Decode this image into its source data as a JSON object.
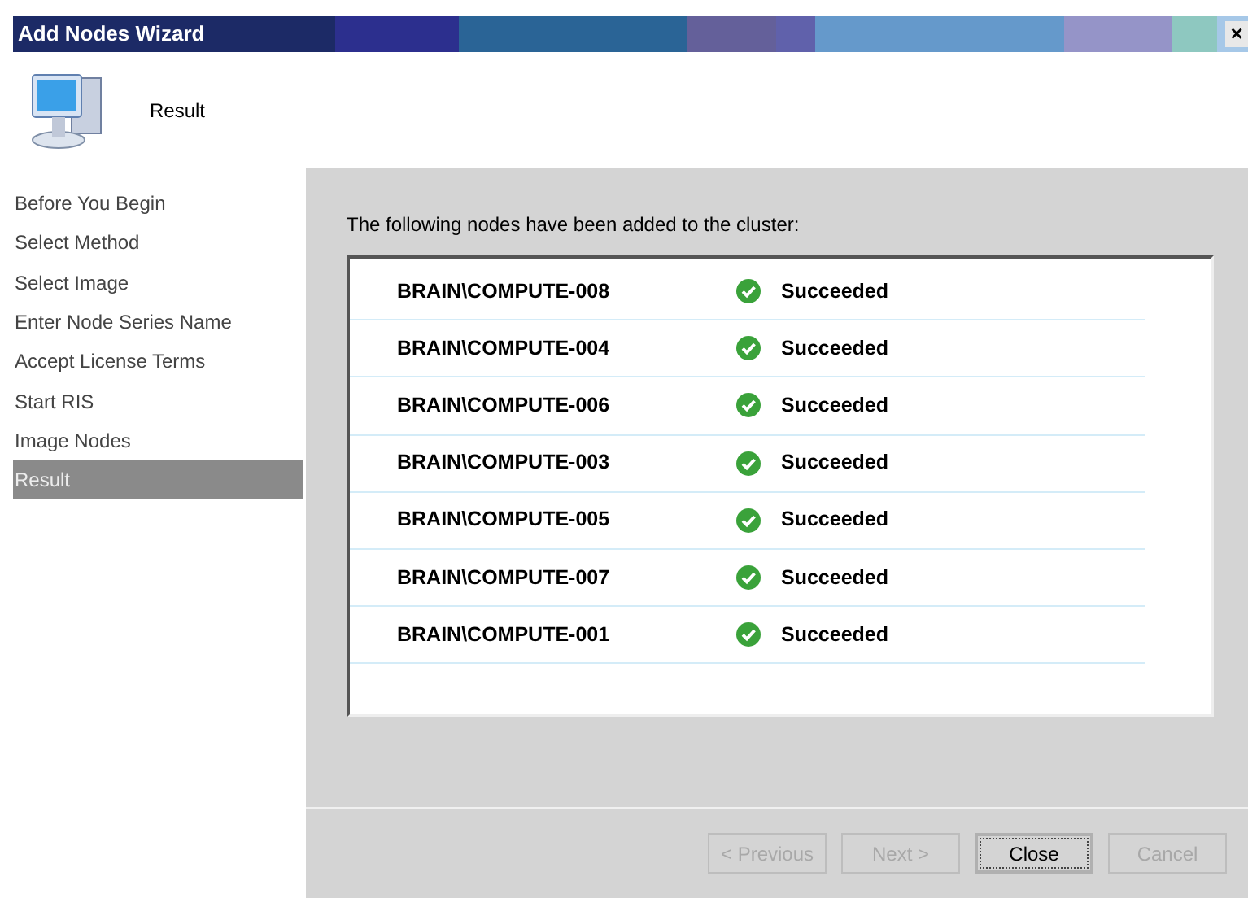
{
  "window": {
    "title": "Add Nodes Wizard",
    "close": "×"
  },
  "header": {
    "title": "Result"
  },
  "steps": [
    {
      "label": "Before You Begin",
      "selected": false
    },
    {
      "label": "Select Method",
      "selected": false
    },
    {
      "label": "Select Image",
      "selected": false
    },
    {
      "label": "Enter Node Series Name",
      "selected": false
    },
    {
      "label": "Accept License Terms",
      "selected": false
    },
    {
      "label": "Start RIS",
      "selected": false
    },
    {
      "label": "Image Nodes",
      "selected": false
    },
    {
      "label": "Result",
      "selected": true
    }
  ],
  "intro": "The following nodes have been added to the cluster:",
  "nodes": [
    {
      "name": "BRAIN\\COMPUTE-008",
      "status": "Succeeded"
    },
    {
      "name": "BRAIN\\COMPUTE-004",
      "status": "Succeeded"
    },
    {
      "name": "BRAIN\\COMPUTE-006",
      "status": "Succeeded"
    },
    {
      "name": "BRAIN\\COMPUTE-003",
      "status": "Succeeded"
    },
    {
      "name": "BRAIN\\COMPUTE-005",
      "status": "Succeeded"
    },
    {
      "name": "BRAIN\\COMPUTE-007",
      "status": "Succeeded"
    },
    {
      "name": "BRAIN\\COMPUTE-001",
      "status": "Succeeded"
    }
  ],
  "buttons": [
    {
      "label": "< Previous",
      "disabled": true,
      "default": false
    },
    {
      "label": "Next >",
      "disabled": true,
      "default": false
    },
    {
      "label": "Close",
      "disabled": false,
      "default": true
    },
    {
      "label": "Cancel",
      "disabled": true,
      "default": false
    }
  ]
}
